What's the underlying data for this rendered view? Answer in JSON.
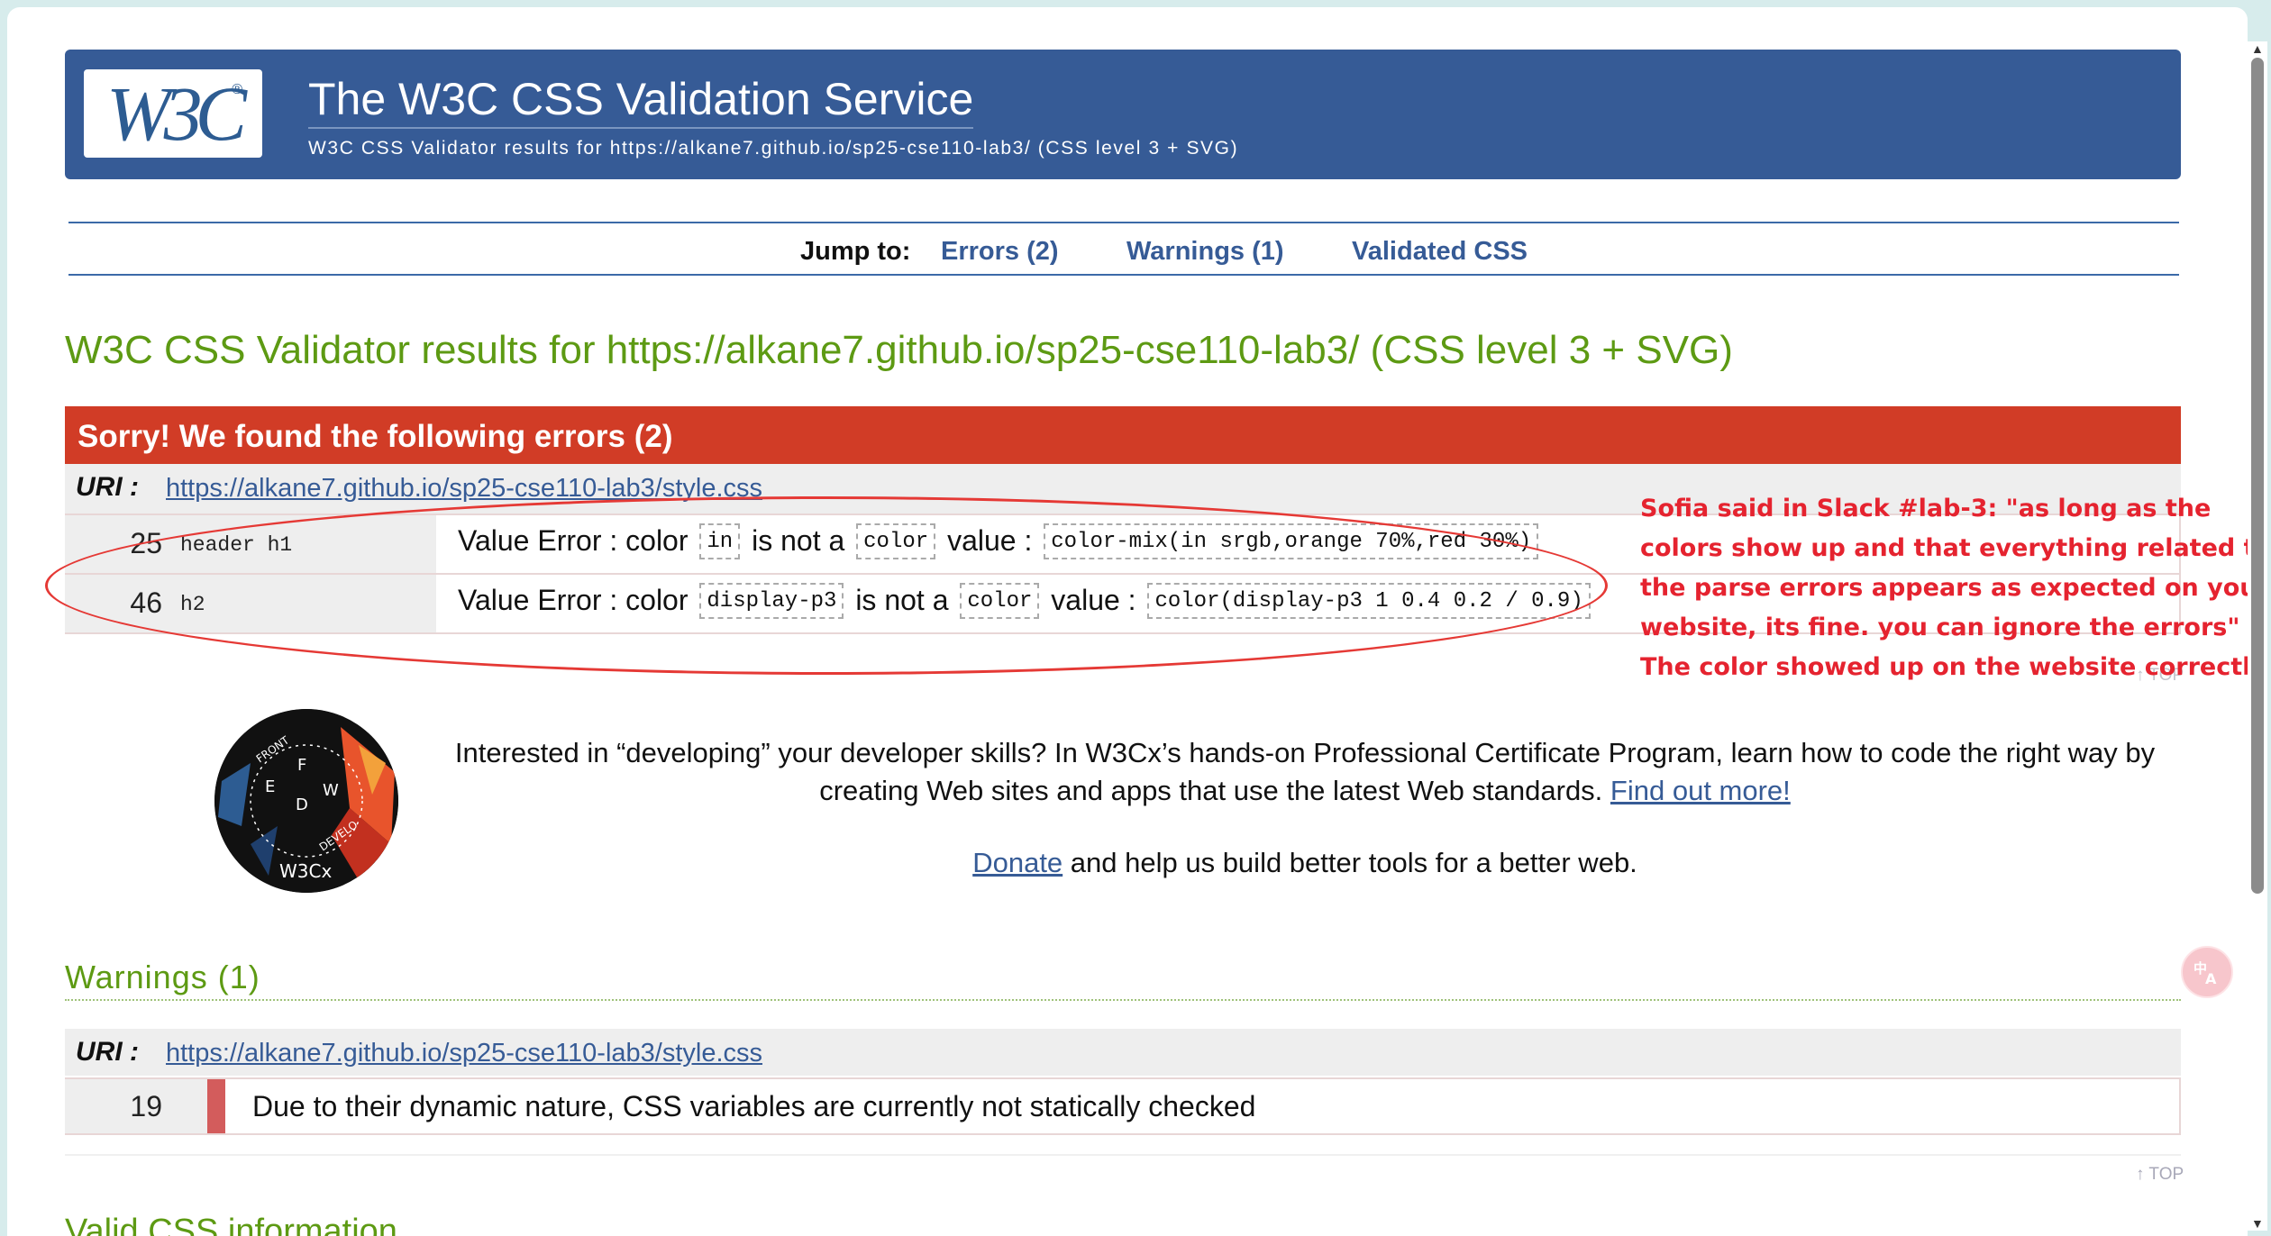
{
  "banner": {
    "logo_text": "W3C",
    "logo_reg": "®",
    "title": "The W3C CSS Validation Service",
    "subtitle": "W3C CSS Validator results for https://alkane7.github.io/sp25-cse110-lab3/ (CSS level 3 + SVG)"
  },
  "jump": {
    "label": "Jump to:",
    "errors": "Errors (2)",
    "warnings": "Warnings (1)",
    "validated": "Validated CSS"
  },
  "results_title": "W3C CSS Validator results for https://alkane7.github.io/sp25-cse110-lab3/ (CSS level 3 + SVG)",
  "errors": {
    "header": "Sorry! We found the following errors (2)",
    "uri_label": "URI :",
    "uri": "https://alkane7.github.io/sp25-cse110-lab3/style.css",
    "rows": [
      {
        "line": "25",
        "context": "header h1",
        "prefix": "Value Error : color",
        "code1": "in",
        "mid": "is not a",
        "code2": "color",
        "value_label": "value :",
        "code3": "color-mix(in srgb,orange 70%,red 30%)"
      },
      {
        "line": "46",
        "context": "h2",
        "prefix": "Value Error : color",
        "code1": "display-p3",
        "mid": "is not a",
        "code2": "color",
        "value_label": "value :",
        "code3": "color(display-p3 1 0.4 0.2 / 0.9)"
      }
    ]
  },
  "annotation": {
    "lines": [
      "Sofia said in Slack #lab-3: \"as long as the",
      "colors show up and that everything related to",
      "the parse errors appears as expected on your",
      "website, its fine. you can ignore the errors\"",
      "The color showed up on the website correctly."
    ],
    "color": "#e5232f"
  },
  "promo": {
    "badge_icon": "front-end-web-developer-badge-icon",
    "badge_text": "W3Cx",
    "text": "Interested in “developing” your developer skills? In W3Cx’s hands-on Professional Certificate Program, learn how to code the right way by creating Web sites and apps that use the latest Web standards.",
    "link": "Find out more!",
    "donate_link": "Donate",
    "donate_text": " and help us build better tools for a better web."
  },
  "warnings": {
    "title": "Warnings (1)",
    "uri_label": "URI :",
    "uri": "https://alkane7.github.io/sp25-cse110-lab3/style.css",
    "rows": [
      {
        "line": "19",
        "message": "Due to their dynamic nature, CSS variables are currently not statically checked"
      }
    ]
  },
  "top_link": "↑ TOP",
  "valid_title": "Valid CSS information",
  "colors": {
    "banner": "#365b96",
    "accent_green": "#5d9a13",
    "error_red": "#d13c26"
  },
  "icons": {
    "scroll_up": "scroll-up-icon",
    "scroll_down": "scroll-down-icon",
    "translate": "translate-icon"
  }
}
